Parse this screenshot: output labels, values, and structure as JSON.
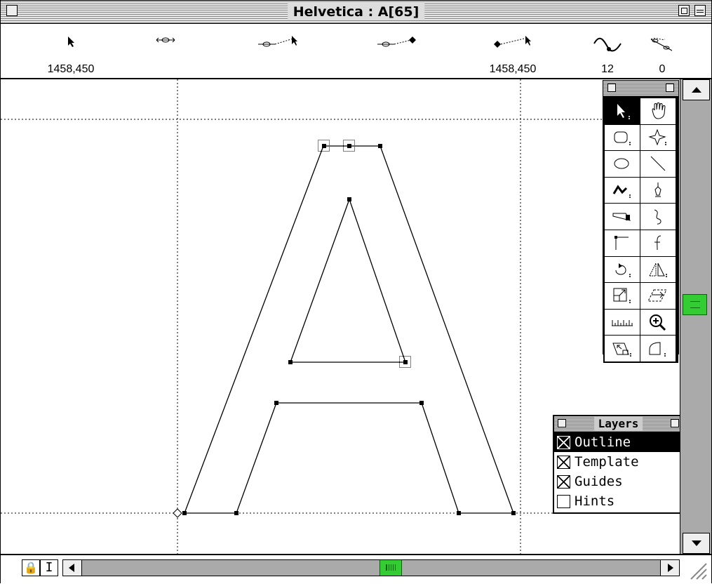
{
  "window": {
    "title": "Helvetica : A[65]"
  },
  "toolbar": {
    "items": [
      {
        "icon": "pointer-icon",
        "value": "1458,450"
      },
      {
        "icon": "point-icon",
        "value": ""
      },
      {
        "icon": "point-to-pointer-icon",
        "value": ""
      },
      {
        "icon": "point-to-point-icon",
        "value": ""
      },
      {
        "icon": "offcurve-to-pointer-icon",
        "value": "1458,450"
      },
      {
        "icon": "curve-icon",
        "value": "12"
      },
      {
        "icon": "angle-icon",
        "value": "0"
      }
    ]
  },
  "tools_palette": {
    "tools": [
      {
        "icon": "arrow-tool-icon",
        "selected": true
      },
      {
        "icon": "hand-tool-icon"
      },
      {
        "icon": "rounded-rect-tool-icon"
      },
      {
        "icon": "star-tool-icon"
      },
      {
        "icon": "ellipse-tool-icon"
      },
      {
        "icon": "line-tool-icon"
      },
      {
        "icon": "freehand-tool-icon"
      },
      {
        "icon": "pen-tool-icon"
      },
      {
        "icon": "knife-tool-icon"
      },
      {
        "icon": "curve-tool-icon"
      },
      {
        "icon": "corner-tool-icon"
      },
      {
        "icon": "tangent-tool-icon"
      },
      {
        "icon": "rotate-tool-icon"
      },
      {
        "icon": "reflect-tool-icon"
      },
      {
        "icon": "scale-tool-icon"
      },
      {
        "icon": "skew-tool-icon"
      },
      {
        "icon": "ruler-tool-icon"
      },
      {
        "icon": "zoom-tool-icon"
      },
      {
        "icon": "perspective-tool-icon"
      },
      {
        "icon": "shape-tool-icon"
      }
    ]
  },
  "layers_panel": {
    "title": "Layers",
    "layers": [
      {
        "label": "Outline",
        "checked": true,
        "selected": true
      },
      {
        "label": "Template",
        "checked": true,
        "selected": false
      },
      {
        "label": "Guides",
        "checked": true,
        "selected": false
      },
      {
        "label": "Hints",
        "checked": false,
        "selected": false
      }
    ]
  },
  "statusbar": {
    "lock_glyph": "🔒",
    "cursor_glyph": "I"
  },
  "colors": {
    "scroll_thumb": "#33cc33",
    "selection": "#000000"
  }
}
